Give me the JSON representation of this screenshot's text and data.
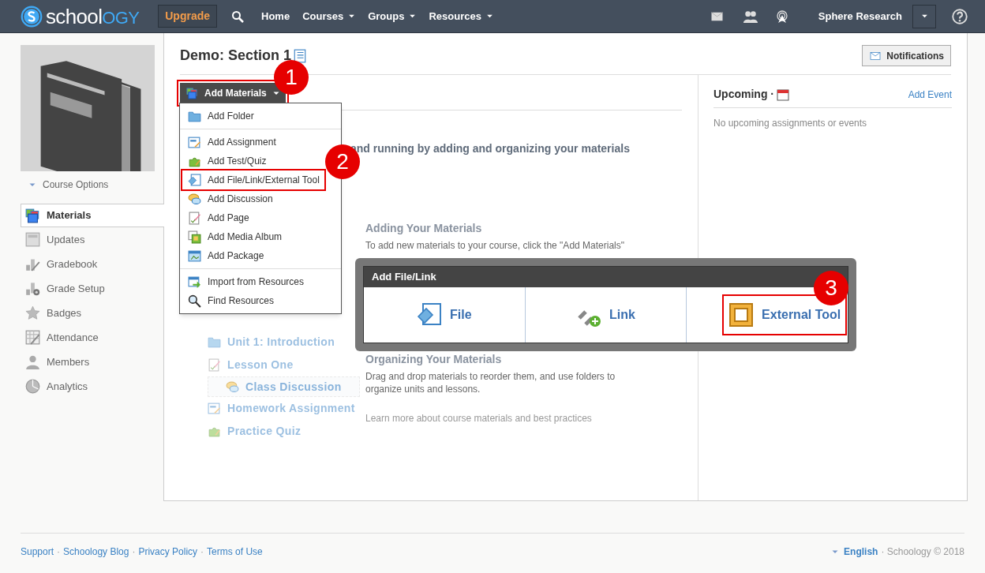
{
  "nav": {
    "logo": [
      "school",
      "OGY"
    ],
    "upgrade": "Upgrade",
    "links": [
      {
        "label": "Home",
        "dropdown": false
      },
      {
        "label": "Courses",
        "dropdown": true
      },
      {
        "label": "Groups",
        "dropdown": true
      },
      {
        "label": "Resources",
        "dropdown": true
      }
    ],
    "user": "Sphere Research"
  },
  "sidebar": {
    "course_options": "Course Options",
    "items": [
      {
        "label": "Materials",
        "kind": "materials",
        "selected": true
      },
      {
        "label": "Updates",
        "kind": "updates",
        "selected": false
      },
      {
        "label": "Gradebook",
        "kind": "gradebook",
        "selected": false
      },
      {
        "label": "Grade Setup",
        "kind": "gradesetup",
        "selected": false
      },
      {
        "label": "Badges",
        "kind": "badges",
        "selected": false
      },
      {
        "label": "Attendance",
        "kind": "attendance",
        "selected": false
      },
      {
        "label": "Members",
        "kind": "members",
        "selected": false
      },
      {
        "label": "Analytics",
        "kind": "analytics",
        "selected": false
      }
    ]
  },
  "page": {
    "title": "Demo: Section 1",
    "notifications": "Notifications",
    "add_materials": {
      "label": "Add Materials",
      "step": "1"
    },
    "intro": "and running by adding and organizing your materials",
    "sections": [
      {
        "heading": "Adding Your Materials",
        "text": "To add new materials to your course, click the \"Add Materials\""
      },
      {
        "heading": "Organizing Your Materials",
        "text": "Drag and drop materials to reorder them, and use folders to organize units and lessons."
      }
    ],
    "learn_more": "Learn more about course materials and best practices",
    "sample_tree": [
      {
        "label": "Unit 1: Introduction",
        "kind": "folder",
        "dragging": false
      },
      {
        "label": "Lesson One",
        "kind": "page",
        "dragging": false
      },
      {
        "label": "Class Discussion",
        "kind": "discussion",
        "dragging": true
      },
      {
        "label": "Homework Assignment",
        "kind": "assignment",
        "dragging": false
      },
      {
        "label": "Practice Quiz",
        "kind": "quiz",
        "dragging": false
      }
    ]
  },
  "menu": [
    [
      {
        "label": "Add Folder",
        "kind": "folder"
      }
    ],
    [
      {
        "label": "Add Assignment",
        "kind": "assignment"
      },
      {
        "label": "Add Test/Quiz",
        "kind": "quiz"
      },
      {
        "label": "Add File/Link/External Tool",
        "kind": "file",
        "step": "2"
      },
      {
        "label": "Add Discussion",
        "kind": "discussion"
      },
      {
        "label": "Add Page",
        "kind": "page"
      },
      {
        "label": "Add Media Album",
        "kind": "media"
      },
      {
        "label": "Add Package",
        "kind": "package"
      }
    ],
    [
      {
        "label": "Import from Resources",
        "kind": "import"
      },
      {
        "label": "Find Resources",
        "kind": "search"
      }
    ]
  ],
  "dialog": {
    "title": "Add File/Link",
    "options": [
      {
        "label": "File",
        "kind": "file"
      },
      {
        "label": "Link",
        "kind": "link"
      },
      {
        "label": "External Tool",
        "kind": "tool",
        "step": "3"
      }
    ]
  },
  "upcoming": {
    "title": "Upcoming ·",
    "add_event": "Add Event",
    "empty": "No upcoming assignments or events"
  },
  "footer": {
    "links": [
      "Support",
      "Schoology Blog",
      "Privacy Policy",
      "Terms of Use"
    ],
    "separator": "·",
    "language": "English",
    "copyright": "· Schoology © 2018"
  }
}
